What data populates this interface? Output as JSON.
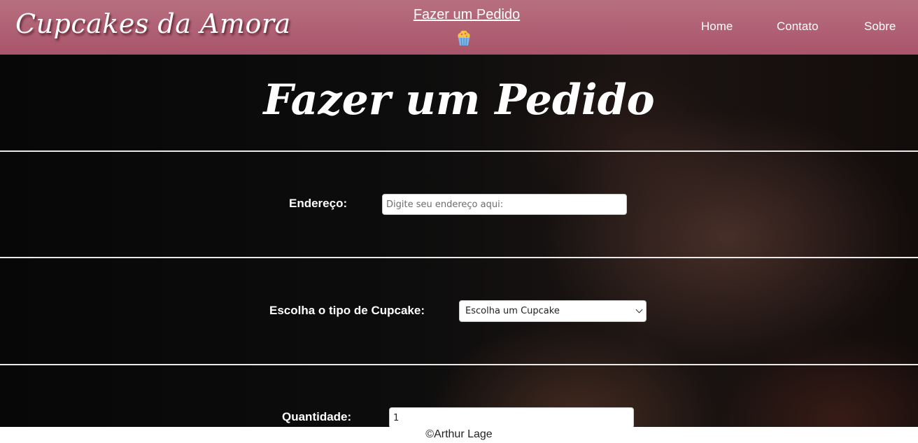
{
  "header": {
    "brand": "Cupcakes da Amora",
    "center_link": "Fazer um Pedido",
    "nav": [
      "Home",
      "Contato",
      "Sobre"
    ]
  },
  "main": {
    "title": "Fazer um Pedido",
    "address": {
      "label": "Endereço:",
      "placeholder": "Digite seu endereço aqui:"
    },
    "cupcake_type": {
      "label": "Escolha o tipo de Cupcake:",
      "selected": "Escolha um Cupcake"
    },
    "quantity": {
      "label": "Quantidade:",
      "value": "1"
    }
  },
  "footer": {
    "copyright": "©Arthur Lage"
  },
  "colors": {
    "header_top": "#b7707f",
    "header_bottom": "#a9546a",
    "background": "#0b0b0b",
    "divider": "#e9e9e9"
  },
  "icons": {
    "center_icon": "cupcake-icon"
  }
}
